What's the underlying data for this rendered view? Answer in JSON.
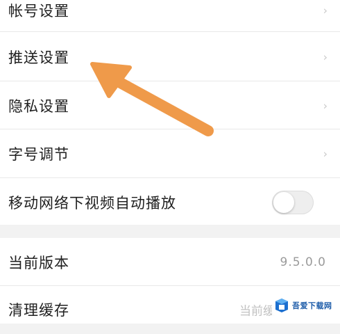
{
  "settings": {
    "items": [
      {
        "label": "帐号设置"
      },
      {
        "label": "推送设置"
      },
      {
        "label": "隐私设置"
      },
      {
        "label": "字号调节"
      },
      {
        "label": "移动网络下视频自动播放",
        "toggle": false
      }
    ],
    "about": [
      {
        "label": "当前版本",
        "value": "9.5.0.0"
      },
      {
        "label": "清理缓存",
        "value": "当前缓"
      }
    ]
  },
  "icons": {
    "chevron": "chevron-right-icon",
    "annotation": "arrow-annotation"
  },
  "colors": {
    "arrow": "#ef9a4a",
    "background": "#f2f2f2",
    "row": "#ffffff"
  },
  "watermark": {
    "text": "吾爱下载网"
  }
}
